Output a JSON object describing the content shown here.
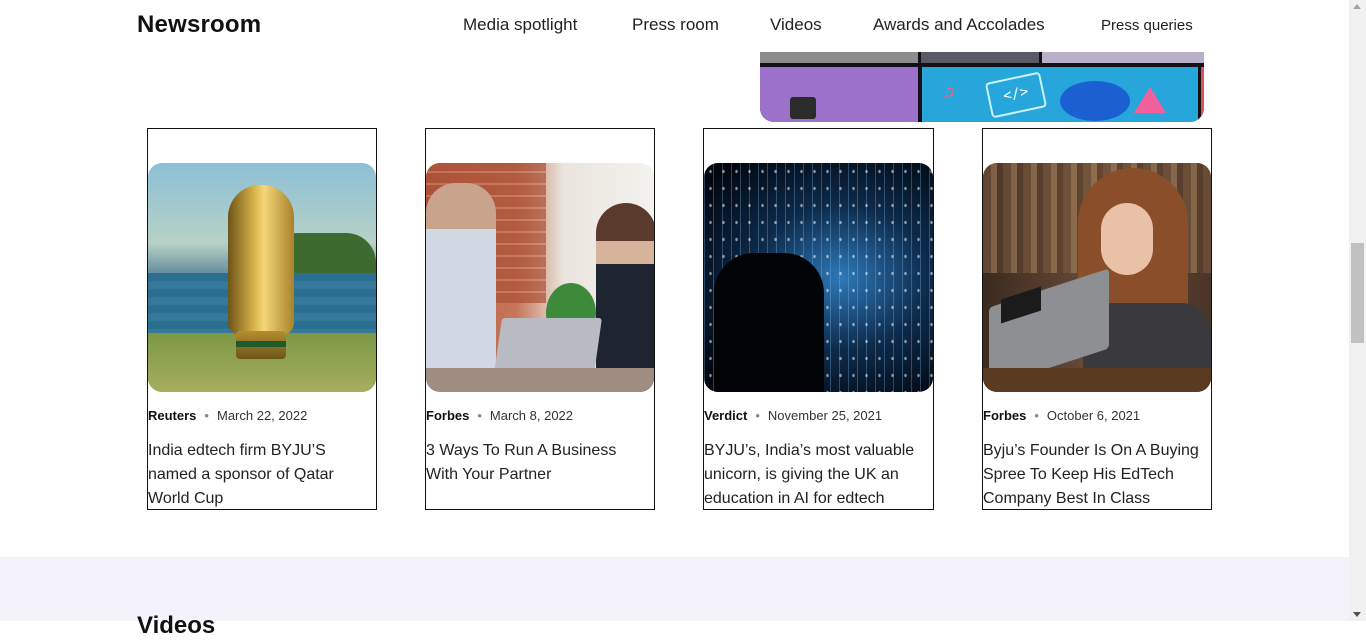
{
  "header": {
    "brand": "Newsroom",
    "nav": [
      {
        "label": "Media spotlight"
      },
      {
        "label": "Press room"
      },
      {
        "label": "Videos"
      },
      {
        "label": "Awards and Accolades"
      },
      {
        "label": "Press queries"
      }
    ]
  },
  "cards": [
    {
      "source": "Reuters",
      "date": "March 22, 2022",
      "title": "India edtech firm BYJU’S named a sponsor of Qatar World Cup",
      "image": "world-cup-trophy"
    },
    {
      "source": "Forbes",
      "date": "March 8, 2022",
      "title": "3 Ways To Run A Business With Your Partner",
      "image": "business-partners-high-five"
    },
    {
      "source": "Verdict",
      "date": "November 25, 2021",
      "title": "BYJU’s, India’s most valuable unicorn, is giving the UK an education in AI for edtech",
      "image": "digital-light-installation"
    },
    {
      "source": "Forbes",
      "date": "October 6, 2021",
      "title": "Byju’s Founder Is On A Buying Spree To Keep His EdTech Company Best In Class",
      "image": "girl-using-laptop"
    }
  ],
  "videos": {
    "heading": "Videos"
  },
  "icons": {
    "separator": "•",
    "music_note": "♫",
    "code": "</>"
  },
  "colors": {
    "section_background": "#f4f3fb",
    "card_border": "#111111"
  }
}
